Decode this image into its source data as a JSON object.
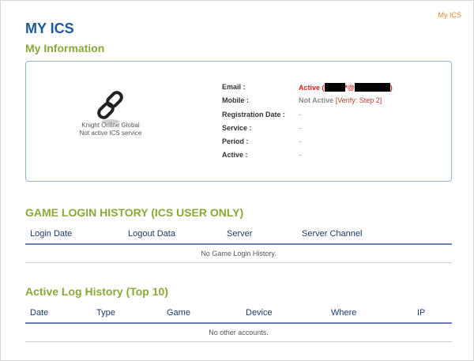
{
  "top_link": "My ICS",
  "page_title": "MY ICS",
  "my_info": {
    "title": "My Information",
    "avatar_caption_line1": "Knight Online Global",
    "avatar_caption_line2": "Not active ICS service",
    "rows": {
      "email": {
        "label": "Email :",
        "status": "Active (",
        "at": "*@",
        "close": ")"
      },
      "mobile": {
        "label": "Mobile :",
        "status": "Not Active",
        "verify": "[Verify: Step 2]"
      },
      "registration": {
        "label": "Registration Date :",
        "value": "-"
      },
      "service": {
        "label": "Service :",
        "value": "-"
      },
      "period": {
        "label": "Period :",
        "value": "-"
      },
      "active": {
        "label": "Active :",
        "value": "-"
      }
    }
  },
  "game_login": {
    "title": "GAME LOGIN HISTORY (ICS USER ONLY)",
    "columns": [
      "Login Date",
      "Logout Data",
      "Server",
      "Server Channel"
    ],
    "empty": "No Game Login History."
  },
  "active_log": {
    "title": "Active Log History (Top 10)",
    "columns": [
      "Date",
      "Type",
      "Game",
      "Device",
      "Where",
      "IP"
    ],
    "empty": "No other accounts."
  },
  "colors": {
    "title_blue": "#1c5a9c",
    "section_green": "#8aa838",
    "active_red": "#e31d1d",
    "link_orange": "#e0862a",
    "table_rule": "#6a7fb2"
  }
}
